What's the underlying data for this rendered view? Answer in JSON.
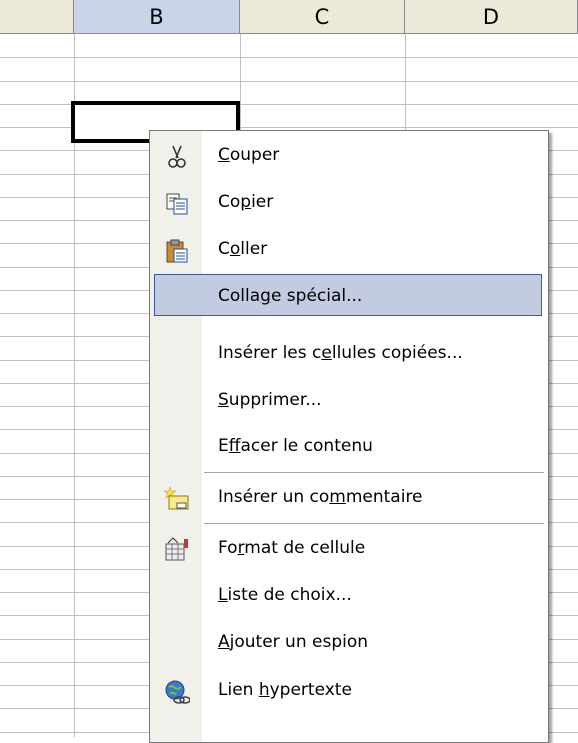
{
  "columns": [
    "B",
    "C",
    "D"
  ],
  "menu": {
    "items": [
      {
        "pre": "",
        "key": "C",
        "post": "ouper",
        "icon": "scissors-icon"
      },
      {
        "pre": "Co",
        "key": "p",
        "post": "ier",
        "icon": "copy-icon"
      },
      {
        "pre": "C",
        "key": "o",
        "post": "ller",
        "icon": "paste-icon"
      },
      {
        "pre": "Colla",
        "key": "g",
        "post": "e spécial...",
        "icon": ""
      },
      {
        "pre": "Insérer les c",
        "key": "e",
        "post": "llules copiées...",
        "icon": ""
      },
      {
        "pre": "",
        "key": "S",
        "post": "upprimer...",
        "icon": ""
      },
      {
        "pre": "E",
        "key": "f",
        "post": "facer le contenu",
        "icon": ""
      },
      {
        "pre": "Insérer un co",
        "key": "m",
        "post": "mentaire",
        "icon": "insert-comment-icon"
      },
      {
        "pre": "Fo",
        "key": "r",
        "post": "mat de cellule",
        "icon": "format-cells-icon"
      },
      {
        "pre": "",
        "key": "L",
        "post": "iste de choix...",
        "icon": ""
      },
      {
        "pre": "",
        "key": "A",
        "post": "jouter un espion",
        "icon": ""
      },
      {
        "pre": "Lien ",
        "key": "h",
        "post": "ypertexte",
        "icon": "hyperlink-icon"
      }
    ],
    "highlighted_index": 3
  },
  "colors": {
    "highlight_fill": "#c2cbe0",
    "highlight_border": "#3b5a9a"
  }
}
